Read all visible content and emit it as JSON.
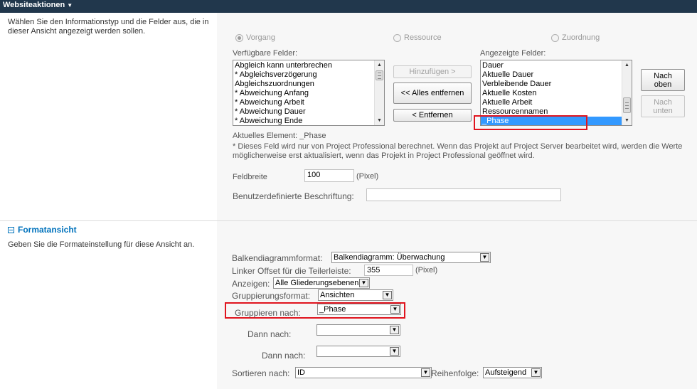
{
  "topbar": {
    "site_actions": "Websiteaktionen"
  },
  "fields_section": {
    "description": "Wählen Sie den Informationstyp und die Felder aus, die in dieser Ansicht angezeigt werden sollen.",
    "radios": [
      {
        "label": "Vorgang",
        "checked": true
      },
      {
        "label": "Ressource",
        "checked": false
      },
      {
        "label": "Zuordnung",
        "checked": false
      }
    ],
    "available_label": "Verfügbare Felder:",
    "available_items": [
      "Abgleich kann unterbrechen",
      "* Abgleichsverzögerung",
      "Abgleichszuordnungen",
      "* Abweichung Anfang",
      "* Abweichung Arbeit",
      "* Abweichung Dauer",
      "* Abweichung Ende"
    ],
    "add_button": "Hinzufügen >",
    "remove_all_button": "<< Alles entfernen",
    "remove_button": "< Entfernen",
    "displayed_label": "Angezeigte Felder:",
    "displayed_items": [
      "Dauer",
      "Aktuelle Dauer",
      "Verbleibende Dauer",
      "Aktuelle Kosten",
      "Aktuelle Arbeit",
      "Ressourcennamen",
      "_Phase"
    ],
    "move_up_button": "Nach oben",
    "move_down_button": "Nach unten",
    "current_element": "Aktuelles Element: _Phase",
    "note": "* Dieses Feld wird nur von Project Professional berechnet. Wenn das Projekt auf Project Server bearbeitet wird, werden die Werte möglicherweise erst aktualisiert, wenn das Projekt in Project Professional geöffnet wird.",
    "field_width_label": "Feldbreite",
    "field_width_value": "100",
    "field_width_unit": "(Pixel)",
    "custom_caption_label": "Benutzerdefinierte Beschriftung:",
    "custom_caption_value": ""
  },
  "format_section": {
    "title": "Formatansicht",
    "description": "Geben Sie die Formateinstellung für diese Ansicht an.",
    "gantt_format_label": "Balkendiagrammformat:",
    "gantt_format_value": "Balkendiagramm: Überwachung",
    "offset_label": "Linker Offset für die Teilerleiste:",
    "offset_value": "355",
    "offset_unit": "(Pixel)",
    "show_label": "Anzeigen:",
    "show_value": "Alle Gliederungsebenen",
    "group_format_label": "Gruppierungsformat:",
    "group_format_value": "Ansichten",
    "group_by_label": "Gruppieren nach:",
    "group_by_value": "_Phase",
    "then_by_1_label": "Dann nach:",
    "then_by_1_value": "",
    "then_by_2_label": "Dann nach:",
    "then_by_2_value": "",
    "sort_by_label": "Sortieren nach:",
    "sort_by_value": "ID",
    "order_label": "Reihenfolge:",
    "order_value": "Aufsteigend"
  },
  "colors": {
    "topbar": "#21374c",
    "highlight": "#e0141e",
    "selection": "#3399ff",
    "section_title": "#0072bc"
  }
}
